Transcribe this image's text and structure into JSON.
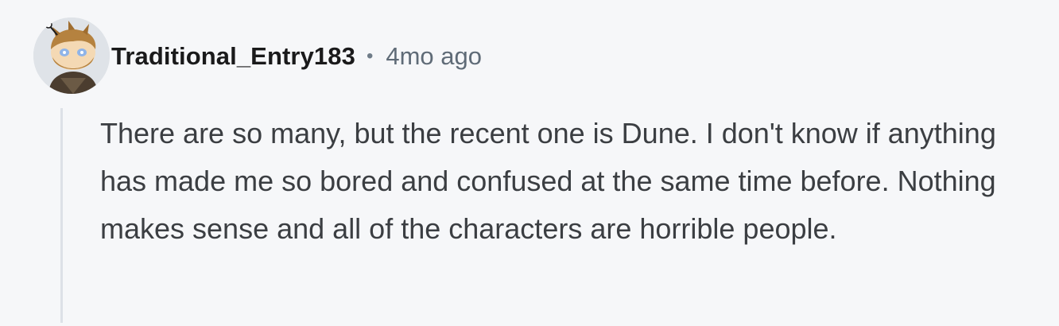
{
  "comment": {
    "author": "Traditional_Entry183",
    "separator": "•",
    "age": "4mo ago",
    "body": "There are so many, but the recent one is Dune. I don't know if anything has made me so bored and confused at the same time before. Nothing makes sense and all of the characters are horrible people."
  },
  "icons": {
    "avatar": "snoo-avatar-icon"
  },
  "colors": {
    "background": "#f6f7f9",
    "username": "#1a1a1b",
    "meta_text": "#5f6b77",
    "body_text": "#3b3e42",
    "thread_line": "#dde1e7"
  }
}
